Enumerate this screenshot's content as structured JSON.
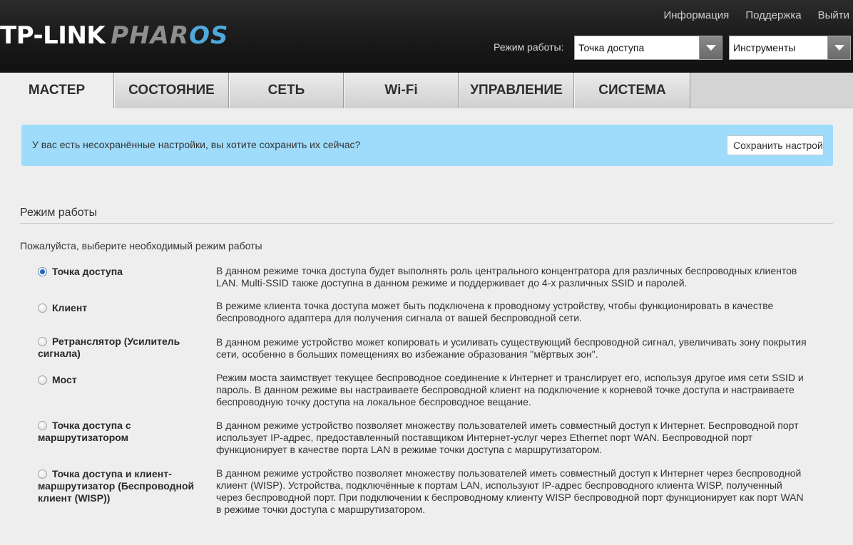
{
  "brand": {
    "part1": "TP-LINK",
    "part2": "PHAR",
    "part3": "OS",
    "accent": "#4fa8dc"
  },
  "toplinks": [
    "Информация",
    "Поддержка",
    "Выйти"
  ],
  "header": {
    "mode_label": "Режим работы:",
    "mode_value": "Точка доступа",
    "tools_value": "Инструменты"
  },
  "tabs": [
    "МАСТЕР",
    "СОСТОЯНИЕ",
    "СЕТЬ",
    "Wi-Fi",
    "УПРАВЛЕНИЕ",
    "СИСТЕМА"
  ],
  "banner": {
    "text": "У вас есть несохранённые настройки, вы хотите сохранить их сейчас?",
    "button": "Сохранить настройки",
    "color": "#9fdcfb"
  },
  "section": {
    "title": "Режим работы",
    "intro": "Пожалуйста, выберите необходимый режим работы"
  },
  "options": [
    {
      "label": "Точка доступа",
      "checked": true,
      "desc": "В данном режиме точка доступа будет выполнять роль центрального концентратора для различных беспроводных клиентов LAN. Multi-SSID также доступна в данном режиме и поддерживает до 4-х различных SSID и паролей."
    },
    {
      "label": "Клиент",
      "checked": false,
      "desc": "В режиме клиента точка доступа может быть подключена к проводному устройству, чтобы функционировать в качестве беспроводного адаптера для получения сигнала от вашей беспроводной сети."
    },
    {
      "label": "Ретранслятор (Усилитель сигнала)",
      "checked": false,
      "desc": "В данном режиме устройство может копировать и усиливать существующий беспроводной сигнал, увеличивать зону покрытия сети, особенно в больших помещениях во избежание образования \"мёртвых зон\"."
    },
    {
      "label": "Мост",
      "checked": false,
      "desc": "Режим моста заимствует текущее беспроводное соединение к Интернет и транслирует его, используя другое имя сети SSID и пароль. В данном режиме вы настраиваете беспроводной клиент на подключение к корневой точке доступа и настраиваете беспроводную точку доступа на локальное беспроводное вещание."
    },
    {
      "label": "Точка доступа с маршрутизатором",
      "checked": false,
      "desc": "В данном режиме устройство позволяет множеству пользователей иметь совместный доступ к Интернет. Беспроводной порт использует IP-адрес, предоставленный поставщиком Интернет-услуг через Ethernet порт WAN. Беспроводной порт функционирует в качестве порта LAN в режиме точки доступа с маршрутизатором."
    },
    {
      "label": "Точка доступа и клиент-маршрутизатор (Беспроводной клиент (WISP))",
      "checked": false,
      "desc": "В данном режиме устройство позволяет множеству пользователей иметь совместный доступ к Интернет через беспроводной клиент (WISP). Устройства, подключённые к портам LAN, используют IP-адрес беспроводного клиента WISP, полученный через беспроводной порт. При подключении к беспроводному клиенту WISP беспроводной порт функционирует как порт WAN в режиме точки доступа с маршрутизатором."
    }
  ]
}
